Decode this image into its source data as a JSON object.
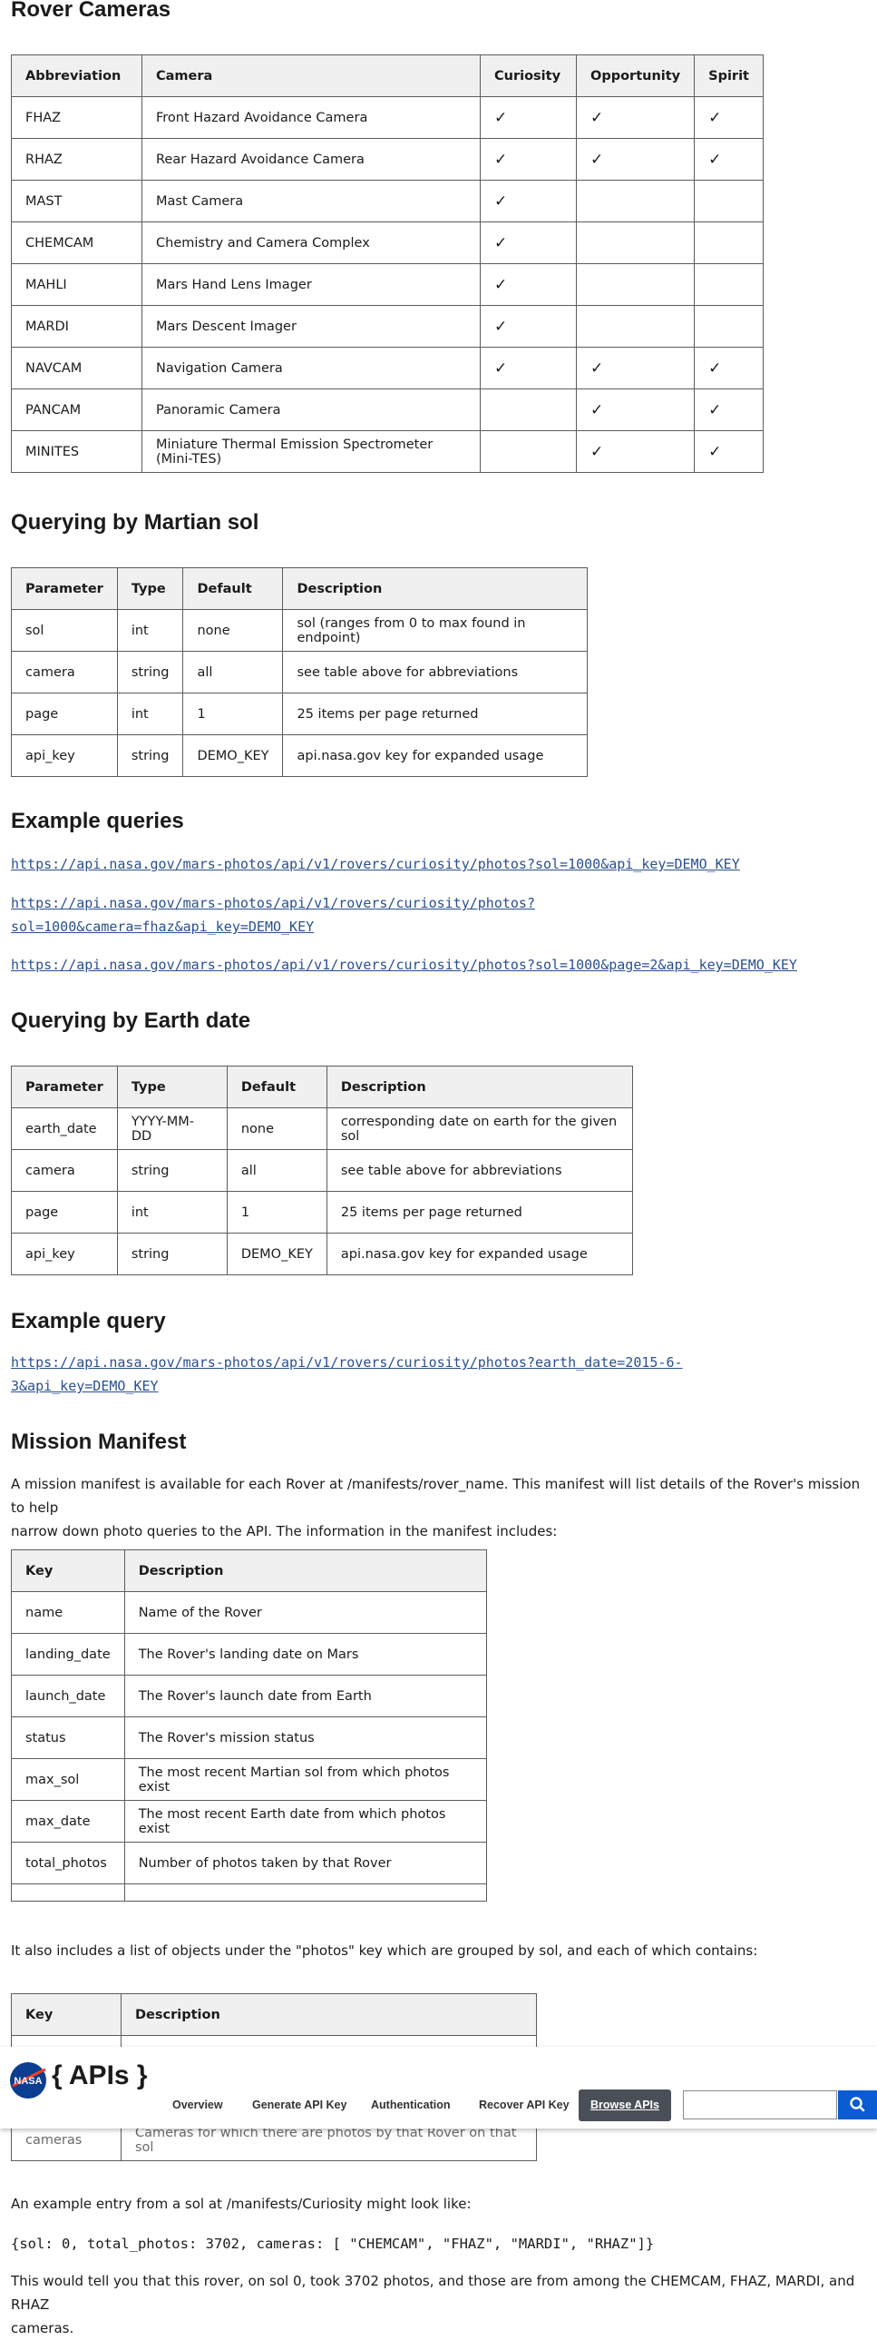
{
  "rover_cameras": {
    "heading": "Rover Cameras",
    "headers": [
      "Abbreviation",
      "Camera",
      "Curiosity",
      "Opportunity",
      "Spirit"
    ],
    "rows": [
      [
        "FHAZ",
        "Front Hazard Avoidance Camera",
        "✓",
        "✓",
        "✓"
      ],
      [
        "RHAZ",
        "Rear Hazard Avoidance Camera",
        "✓",
        "✓",
        "✓"
      ],
      [
        "MAST",
        "Mast Camera",
        "✓",
        "",
        ""
      ],
      [
        "CHEMCAM",
        "Chemistry and Camera Complex",
        "✓",
        "",
        ""
      ],
      [
        "MAHLI",
        "Mars Hand Lens Imager",
        "✓",
        "",
        ""
      ],
      [
        "MARDI",
        "Mars Descent Imager",
        "✓",
        "",
        ""
      ],
      [
        "NAVCAM",
        "Navigation Camera",
        "✓",
        "✓",
        "✓"
      ],
      [
        "PANCAM",
        "Panoramic Camera",
        "",
        "✓",
        "✓"
      ],
      [
        "MINITES",
        "Miniature Thermal Emission Spectrometer (Mini-TES)",
        "",
        "✓",
        "✓"
      ]
    ]
  },
  "sol_query": {
    "heading": "Querying by Martian sol",
    "headers": [
      "Parameter",
      "Type",
      "Default",
      "Description"
    ],
    "rows": [
      [
        "sol",
        "int",
        "none",
        "sol (ranges from 0 to max found in endpoint)"
      ],
      [
        "camera",
        "string",
        "all",
        "see table above for abbreviations"
      ],
      [
        "page",
        "int",
        "1",
        "25 items per page returned"
      ],
      [
        "api_key",
        "string",
        "DEMO_KEY",
        "api.nasa.gov key for expanded usage"
      ]
    ]
  },
  "example_queries": {
    "heading": "Example queries",
    "links": [
      "https://api.nasa.gov/mars-photos/api/v1/rovers/curiosity/photos?sol=1000&api_key=DEMO_KEY",
      "https://api.nasa.gov/mars-photos/api/v1/rovers/curiosity/photos?",
      "sol=1000&camera=fhaz&api_key=DEMO_KEY",
      "https://api.nasa.gov/mars-photos/api/v1/rovers/curiosity/photos?sol=1000&page=2&api_key=DEMO_KEY"
    ]
  },
  "earth_query": {
    "heading": "Querying by Earth date",
    "headers": [
      "Parameter",
      "Type",
      "Default",
      "Description"
    ],
    "rows": [
      [
        "earth_date",
        "YYYY-MM-DD",
        "none",
        "corresponding date on earth for the given sol"
      ],
      [
        "camera",
        "string",
        "all",
        "see table above for abbreviations"
      ],
      [
        "page",
        "int",
        "1",
        "25 items per page returned"
      ],
      [
        "api_key",
        "string",
        "DEMO_KEY",
        "api.nasa.gov key for expanded usage"
      ]
    ]
  },
  "example_query": {
    "heading": "Example query",
    "link_line1": "https://api.nasa.gov/mars-photos/api/v1/rovers/curiosity/photos?earth_date=2015-6-",
    "link_line2": "3&api_key=DEMO_KEY"
  },
  "manifest": {
    "heading": "Mission Manifest",
    "intro_line1": "A mission manifest is available for each Rover at /manifests/rover_name. This manifest will list details of the Rover's mission to help",
    "intro_line2": "narrow down photo queries to the API. The information in the manifest includes:",
    "headers": [
      "Key",
      "Description"
    ],
    "rows": [
      [
        "name",
        "Name of the Rover"
      ],
      [
        "landing_date",
        "The Rover's landing date on Mars"
      ],
      [
        "launch_date",
        "The Rover's launch date from Earth"
      ],
      [
        "status",
        "The Rover's mission status"
      ],
      [
        "max_sol",
        "The most recent Martian sol from which photos exist"
      ],
      [
        "max_date",
        "The most recent Earth date from which photos exist"
      ],
      [
        "total_photos",
        "Number of photos taken by that Rover"
      ],
      [
        "",
        ""
      ]
    ],
    "photos_text": "It also includes a list of objects under the \"photos\" key which are grouped by sol, and each of which contains:",
    "photos_headers": [
      "Key",
      "Description"
    ],
    "photos_partial_row": [
      "cameras",
      "Cameras for which there are photos by that Rover on that sol"
    ],
    "example_intro": "An example entry from a sol at /manifests/Curiosity might look like:",
    "example_code": "{sol: 0, total_photos: 3702, cameras: [ \"CHEMCAM\", \"FHAZ\", \"MARDI\", \"RHAZ\"]}",
    "outro_line1": "This would tell you that this rover, on sol 0, took 3702 photos, and those are from among the CHEMCAM, FHAZ, MARDI, and RHAZ",
    "outro_line2": "cameras."
  },
  "header": {
    "logo_text": "NASA",
    "brand": "{ APIs }",
    "nav": [
      "Overview",
      "Generate API Key",
      "Authentication",
      "Recover API Key"
    ],
    "browse_label": "Browse APIs",
    "search_placeholder": ""
  }
}
